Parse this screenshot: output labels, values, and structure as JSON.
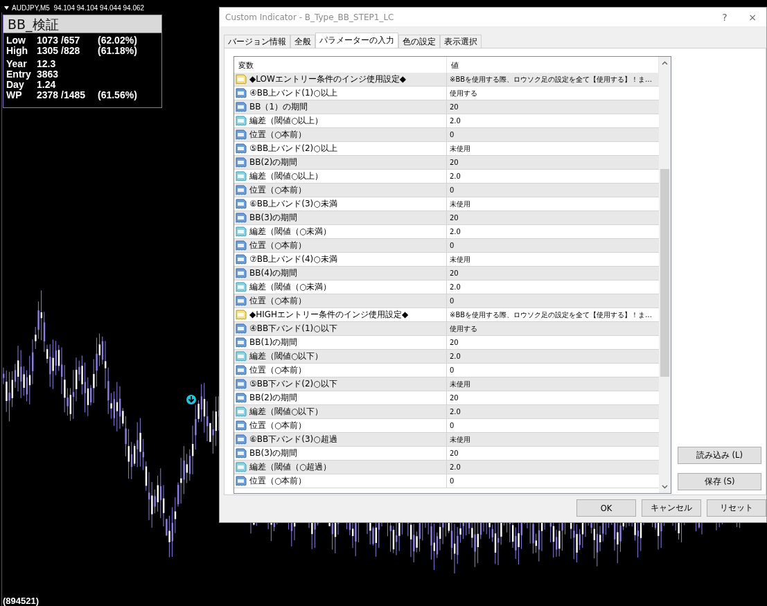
{
  "chart_header": {
    "text": "AUDJPY,M5  94.104 94.104 94.044 94.062"
  },
  "info_panel": {
    "title": "BB_検証",
    "stats": [
      {
        "label": "Low",
        "value": "1073 /657",
        "percent": "(62.02%)"
      },
      {
        "label": "High",
        "value": "1305 /828",
        "percent": "(61.18%)"
      },
      {
        "label": "Year",
        "value": "12.3"
      },
      {
        "label": "Entry",
        "value": "3863"
      },
      {
        "label": "Day",
        "value": "1.24"
      },
      {
        "label": "WP",
        "value": "2378 /1485",
        "percent": "(61.56%)"
      }
    ]
  },
  "bottom_label": "(894521)",
  "window": {
    "title": "Custom Indicator - B_Type_BB_STEP1_LC",
    "help_button": "?",
    "close_button": "×"
  },
  "tabs": [
    {
      "label": "バージョン情報",
      "selected": false
    },
    {
      "label": "全般",
      "selected": false
    },
    {
      "label": "パラメーターの入力",
      "selected": true
    },
    {
      "label": "色の設定",
      "selected": false
    },
    {
      "label": "表示選択",
      "selected": false
    }
  ],
  "table": {
    "columns": [
      "変数",
      "値"
    ],
    "rows": [
      {
        "kind": "string",
        "name": "◆LOWエントリー条件のインジ使用設定◆",
        "value": "※BBを使用する際、ロウソク足の設定を全て【使用する】！ま…"
      },
      {
        "kind": "int",
        "name": "④BB上バンド(1)○以上",
        "value": "使用する"
      },
      {
        "kind": "int",
        "name": "BB（1）の期間",
        "value": "20"
      },
      {
        "kind": "double",
        "name": "編差（閾値○以上）",
        "value": "2.0"
      },
      {
        "kind": "int",
        "name": "位置（○本前）",
        "value": "0"
      },
      {
        "kind": "int",
        "name": "⑤BB上バンド(2)○以上",
        "value": "未使用"
      },
      {
        "kind": "int",
        "name": "BB(2)の期間",
        "value": "20"
      },
      {
        "kind": "double",
        "name": "編差（閾値○以上）",
        "value": "2.0"
      },
      {
        "kind": "int",
        "name": "位置（○本前）",
        "value": "0"
      },
      {
        "kind": "int",
        "name": "⑥BB上バンド(3)○未満",
        "value": "未使用"
      },
      {
        "kind": "int",
        "name": "BB(3)の期間",
        "value": "20"
      },
      {
        "kind": "double",
        "name": "編差（閾値（○未満）",
        "value": "2.0"
      },
      {
        "kind": "int",
        "name": "位置（○本前）",
        "value": "0"
      },
      {
        "kind": "int",
        "name": "⑦BB上バンド(4)○未満",
        "value": "未使用"
      },
      {
        "kind": "int",
        "name": "BB(4)の期間",
        "value": "20"
      },
      {
        "kind": "double",
        "name": "編差（閾値（○未満）",
        "value": "2.0"
      },
      {
        "kind": "int",
        "name": "位置（○本前）",
        "value": "0"
      },
      {
        "kind": "string",
        "name": "◆HIGHエントリー条件のインジ使用設定◆",
        "value": "※BBを使用する際、ロウソク足の設定を全て【使用する】！ま…"
      },
      {
        "kind": "int",
        "name": "④BB下バンド(1)○以下",
        "value": "使用する"
      },
      {
        "kind": "int",
        "name": "BB(1)の期間",
        "value": "20"
      },
      {
        "kind": "double",
        "name": "編差（閾値○以下）",
        "value": "2.0"
      },
      {
        "kind": "int",
        "name": "位置（○本前）",
        "value": "0"
      },
      {
        "kind": "int",
        "name": "⑤BB下バンド(2)○以下",
        "value": "未使用"
      },
      {
        "kind": "int",
        "name": "BB(2)の期間",
        "value": "20"
      },
      {
        "kind": "double",
        "name": "編差（閾値○以下）",
        "value": "2.0"
      },
      {
        "kind": "int",
        "name": "位置（○本前）",
        "value": "0"
      },
      {
        "kind": "int",
        "name": "⑥BB下バンド(3)○超過",
        "value": "未使用"
      },
      {
        "kind": "int",
        "name": "BB(3)の期間",
        "value": "20"
      },
      {
        "kind": "double",
        "name": "編差（閾値（○超過）",
        "value": "2.0"
      },
      {
        "kind": "int",
        "name": "位置（○本前）",
        "value": "0"
      }
    ]
  },
  "side_buttons": [
    "読み込み (L)",
    "保存 (S)"
  ],
  "footer_buttons": [
    "OK",
    "キャンセル",
    "リセット"
  ]
}
